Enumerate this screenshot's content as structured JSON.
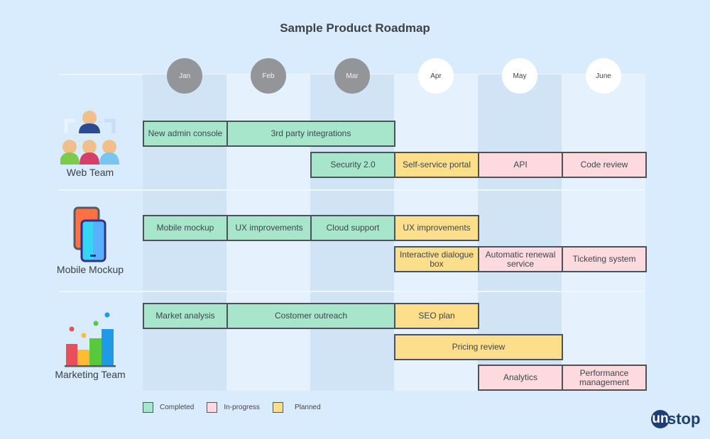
{
  "title": "Sample Product Roadmap",
  "months": [
    {
      "label": "Jan",
      "status": "past"
    },
    {
      "label": "Feb",
      "status": "past"
    },
    {
      "label": "Mar",
      "status": "past"
    },
    {
      "label": "Apr",
      "status": "future"
    },
    {
      "label": "May",
      "status": "future"
    },
    {
      "label": "June",
      "status": "future"
    }
  ],
  "teams": [
    {
      "name": "Web Team",
      "icon": "team-people-icon"
    },
    {
      "name": "Mobile Mockup",
      "icon": "mobile-phones-icon"
    },
    {
      "name": "Marketing Team",
      "icon": "bar-chart-icon"
    }
  ],
  "tasks": [
    {
      "team": 0,
      "lane": 0,
      "start": 0,
      "span": 1,
      "label": "New admin console",
      "status": "completed"
    },
    {
      "team": 0,
      "lane": 0,
      "start": 1,
      "span": 2,
      "label": "3rd party integrations",
      "status": "completed"
    },
    {
      "team": 0,
      "lane": 1,
      "start": 2,
      "span": 1,
      "label": "Security 2.0",
      "status": "completed"
    },
    {
      "team": 0,
      "lane": 1,
      "start": 3,
      "span": 1,
      "label": "Self-service portal",
      "status": "planned"
    },
    {
      "team": 0,
      "lane": 1,
      "start": 4,
      "span": 1,
      "label": "API",
      "status": "in-progress"
    },
    {
      "team": 0,
      "lane": 1,
      "start": 5,
      "span": 1,
      "label": "Code review",
      "status": "in-progress"
    },
    {
      "team": 1,
      "lane": 0,
      "start": 0,
      "span": 1,
      "label": "Mobile mockup",
      "status": "completed"
    },
    {
      "team": 1,
      "lane": 0,
      "start": 1,
      "span": 1,
      "label": "UX improvements",
      "status": "completed"
    },
    {
      "team": 1,
      "lane": 0,
      "start": 2,
      "span": 1,
      "label": "Cloud support",
      "status": "completed"
    },
    {
      "team": 1,
      "lane": 0,
      "start": 3,
      "span": 1,
      "label": "UX improvements",
      "status": "planned"
    },
    {
      "team": 1,
      "lane": 1,
      "start": 3,
      "span": 1,
      "label": "Interactive dialogue box",
      "status": "planned"
    },
    {
      "team": 1,
      "lane": 1,
      "start": 4,
      "span": 1,
      "label": "Automatic renewal service",
      "status": "in-progress"
    },
    {
      "team": 1,
      "lane": 1,
      "start": 5,
      "span": 1,
      "label": "Ticketing system",
      "status": "in-progress"
    },
    {
      "team": 2,
      "lane": 0,
      "start": 0,
      "span": 1,
      "label": "Market analysis",
      "status": "completed"
    },
    {
      "team": 2,
      "lane": 0,
      "start": 1,
      "span": 2,
      "label": "Costomer outreach",
      "status": "completed"
    },
    {
      "team": 2,
      "lane": 0,
      "start": 3,
      "span": 1,
      "label": "SEO plan",
      "status": "planned"
    },
    {
      "team": 2,
      "lane": 1,
      "start": 3,
      "span": 2,
      "label": "Pricing review",
      "status": "planned"
    },
    {
      "team": 2,
      "lane": 2,
      "start": 4,
      "span": 1,
      "label": "Analytics",
      "status": "in-progress"
    },
    {
      "team": 2,
      "lane": 2,
      "start": 5,
      "span": 1,
      "label": "Performance management",
      "status": "in-progress"
    }
  ],
  "legend": [
    {
      "label": "Completed",
      "status": "completed"
    },
    {
      "label": "In-progress",
      "status": "in-progress"
    },
    {
      "label": "Planned",
      "status": "planned"
    }
  ],
  "colors": {
    "completed": "#a8e6cb",
    "in-progress": "#fddadd",
    "planned": "#fddf8b",
    "background": "#d9ecfd"
  },
  "logo": {
    "circle_text": "un",
    "rest_text": "stop"
  }
}
